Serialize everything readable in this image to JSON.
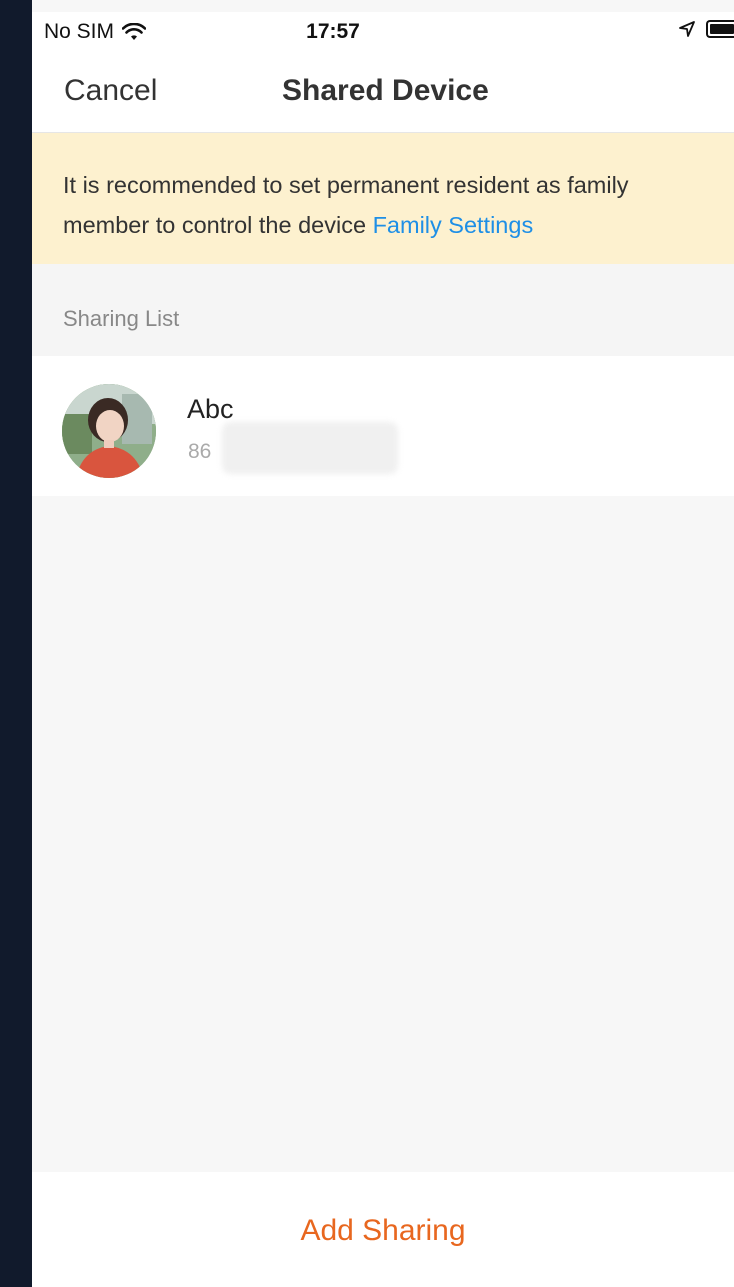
{
  "status_bar": {
    "carrier": "No SIM",
    "time": "17:57"
  },
  "nav": {
    "cancel_label": "Cancel",
    "title": "Shared Device"
  },
  "banner": {
    "message": "It is recommended to set permanent resident as family member to control the device ",
    "link_label": "Family Settings"
  },
  "sharing_list": {
    "header": "Sharing List",
    "items": [
      {
        "name": "Abc",
        "phone": "86"
      }
    ]
  },
  "footer": {
    "add_label": "Add Sharing"
  },
  "colors": {
    "accent": "#e8671f",
    "link": "#1e8fe6",
    "banner_bg": "#fdf1cf"
  }
}
